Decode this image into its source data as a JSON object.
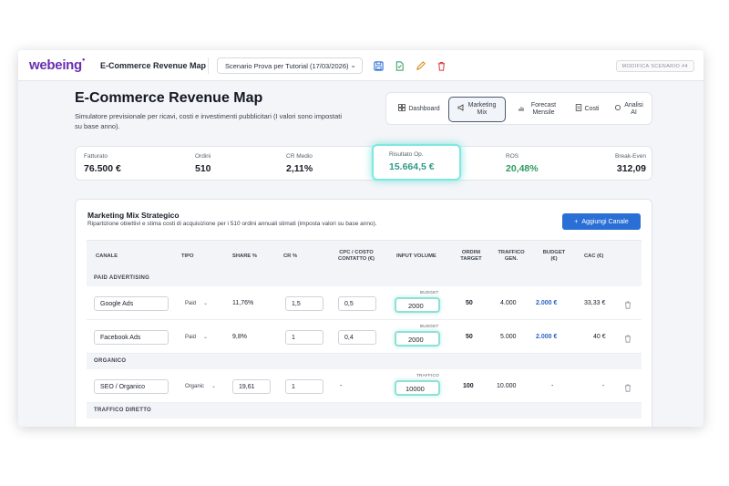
{
  "app": {
    "logo": "webeing",
    "title": "E-Commerce Revenue Map",
    "scenario": "Scenario Prova per Tutorial (17/03/2026)",
    "modify_label": "MODIFICA SCENARIO #4"
  },
  "colors": {
    "brand": "#6a2fb0",
    "accent": "#2a6fd6",
    "positive": "#2f9a5d",
    "highlight": "#7ee8e0"
  },
  "header": {
    "title": "E-Commerce Revenue Map",
    "subtitle": "Simulatore previsionale per ricavi, costi e investimenti pubblicitari (I valori sono impostati su base anno)."
  },
  "tabs": [
    {
      "label": "Dashboard",
      "icon": "grid-icon"
    },
    {
      "label": "Marketing Mix",
      "icon": "megaphone-icon",
      "active": true
    },
    {
      "label": "Forecast Mensile",
      "icon": "chart-icon"
    },
    {
      "label": "Costi",
      "icon": "document-icon"
    },
    {
      "label": "Analisi AI",
      "icon": "sparkle-icon"
    }
  ],
  "kpis": {
    "fatturato": {
      "label": "Fatturato",
      "value": "76.500 €"
    },
    "ordini": {
      "label": "Ordini",
      "value": "510"
    },
    "cr": {
      "label": "CR Medio",
      "value": "2,11%"
    },
    "risultato": {
      "label": "Risultato Op.",
      "value": "15.664,5 €"
    },
    "ros": {
      "label": "ROS",
      "value": "20,48%"
    },
    "breakeven": {
      "label": "Break-Even",
      "value": "312,09"
    }
  },
  "marketing_mix": {
    "title": "Marketing Mix Strategico",
    "subtitle": "Ripartizione obiettivi e stima costi di acquisizione per i 510 ordini annuali stimati (imposta valori su base anno).",
    "add_button": "Aggiungi Canale",
    "columns": {
      "canale": "CANALE",
      "tipo": "TIPO",
      "share": "SHARE %",
      "cr": "CR %",
      "cpc_1": "CPC / COSTO",
      "cpc_2": "CONTATTO (€)",
      "input": "INPUT VOLUME",
      "ordini_1": "ORDINI",
      "ordini_2": "TARGET",
      "traffico_1": "TRAFFICO",
      "traffico_2": "GEN.",
      "budget_1": "BUDGET",
      "budget_2": "(€)",
      "cac": "CAC (€)"
    },
    "sections": {
      "paid": "PAID ADVERTISING",
      "organico": "ORGANICO",
      "diretto": "TRAFFICO DIRETTO"
    },
    "rows": [
      {
        "canale": "Google Ads",
        "tipo": "Paid",
        "share": "11,76%",
        "cr": "1,5",
        "cpc": "0,5",
        "input_label": "BUDGET",
        "input": "2000",
        "ordini": "50",
        "traffico": "4.000",
        "budget": "2.000 €",
        "cac": "33,33 €"
      },
      {
        "canale": "Facebook Ads",
        "tipo": "Paid",
        "share": "9,8%",
        "cr": "1",
        "cpc": "0,4",
        "input_label": "BUDGET",
        "input": "2000",
        "ordini": "50",
        "traffico": "5.000",
        "budget": "2.000 €",
        "cac": "40 €"
      },
      {
        "canale": "SEO / Organico",
        "tipo": "Organic",
        "share": "19,61",
        "cr": "1",
        "cpc": "-",
        "input_label": "TRAFFICO",
        "input": "10000",
        "ordini": "100",
        "traffico": "10.000",
        "budget": "-",
        "cac": "-"
      }
    ]
  }
}
